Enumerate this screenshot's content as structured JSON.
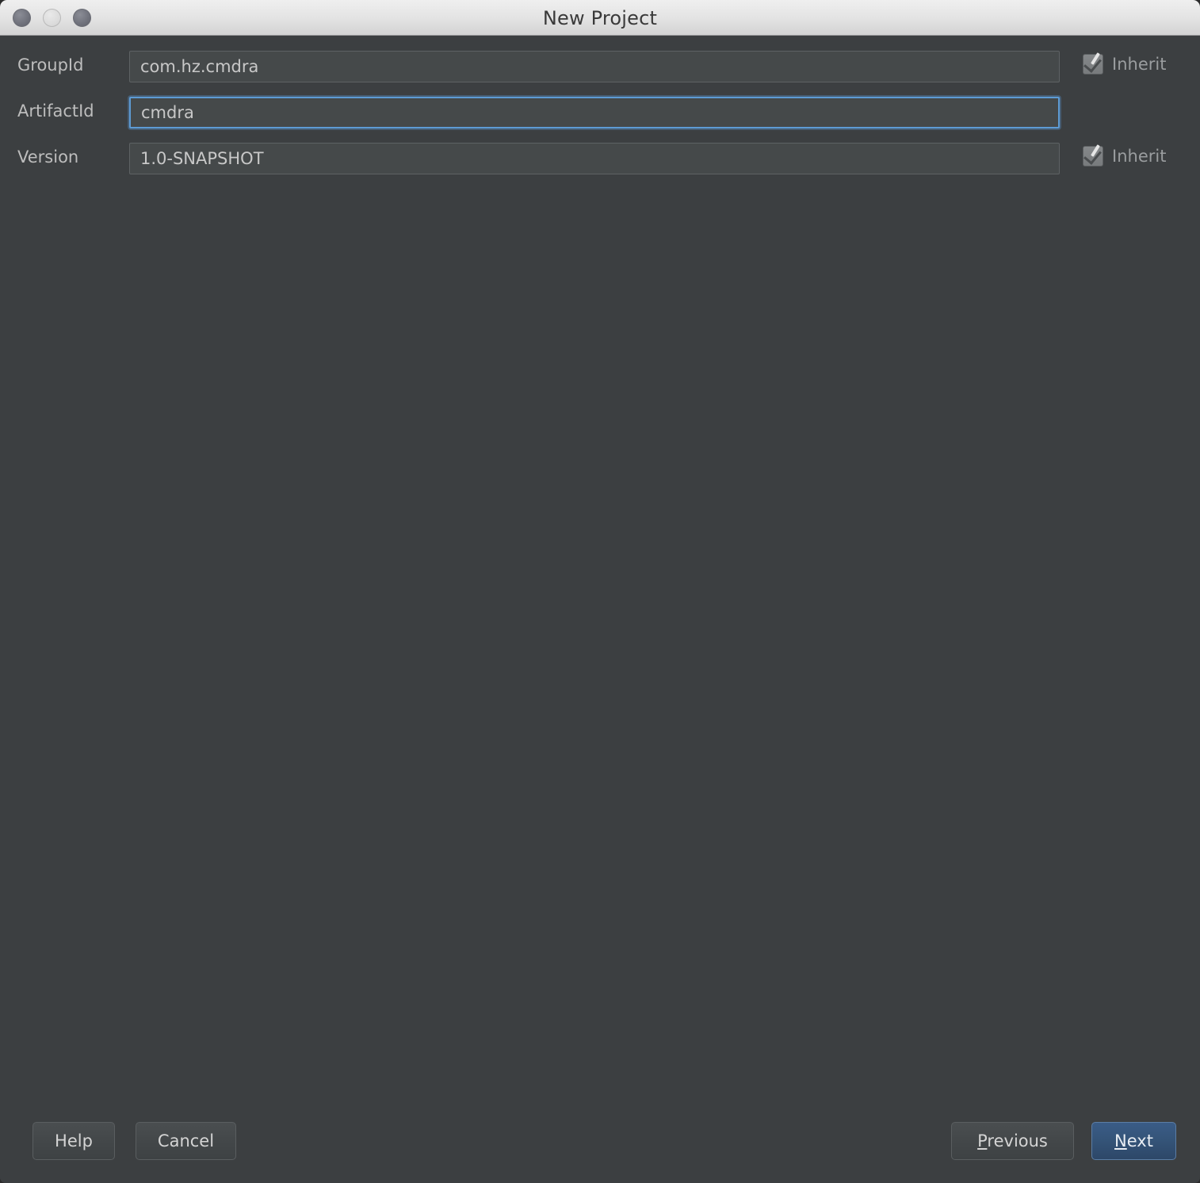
{
  "window": {
    "title": "New Project",
    "controls": [
      {
        "name": "close",
        "label": "Close"
      },
      {
        "name": "minimize",
        "label": "Minimize"
      },
      {
        "name": "zoom",
        "label": "Zoom"
      }
    ]
  },
  "form": {
    "rows": [
      {
        "label": "GroupId",
        "value": "com.hz.cmdra",
        "focused": false,
        "inherit": {
          "label": "Inherit",
          "checked": true,
          "enabled": false
        }
      },
      {
        "label": "ArtifactId",
        "value": "cmdra",
        "focused": true,
        "inherit": null
      },
      {
        "label": "Version",
        "value": "1.0-SNAPSHOT",
        "focused": false,
        "inherit": {
          "label": "Inherit",
          "checked": true,
          "enabled": false
        }
      }
    ]
  },
  "footer": {
    "help_label": "Help",
    "cancel_label": "Cancel",
    "previous_label": "Previous",
    "previous_mnemonic": "P",
    "previous_rest": "revious",
    "next_label": "Next",
    "next_mnemonic": "N",
    "next_rest": "ext"
  },
  "colors": {
    "background": "#3c3f41",
    "titlebar": "#e4e4e4",
    "field_background": "#45494a",
    "focus_ring": "#5d9bd4",
    "default_button": "#345377",
    "label_text": "#bdbdbd"
  }
}
